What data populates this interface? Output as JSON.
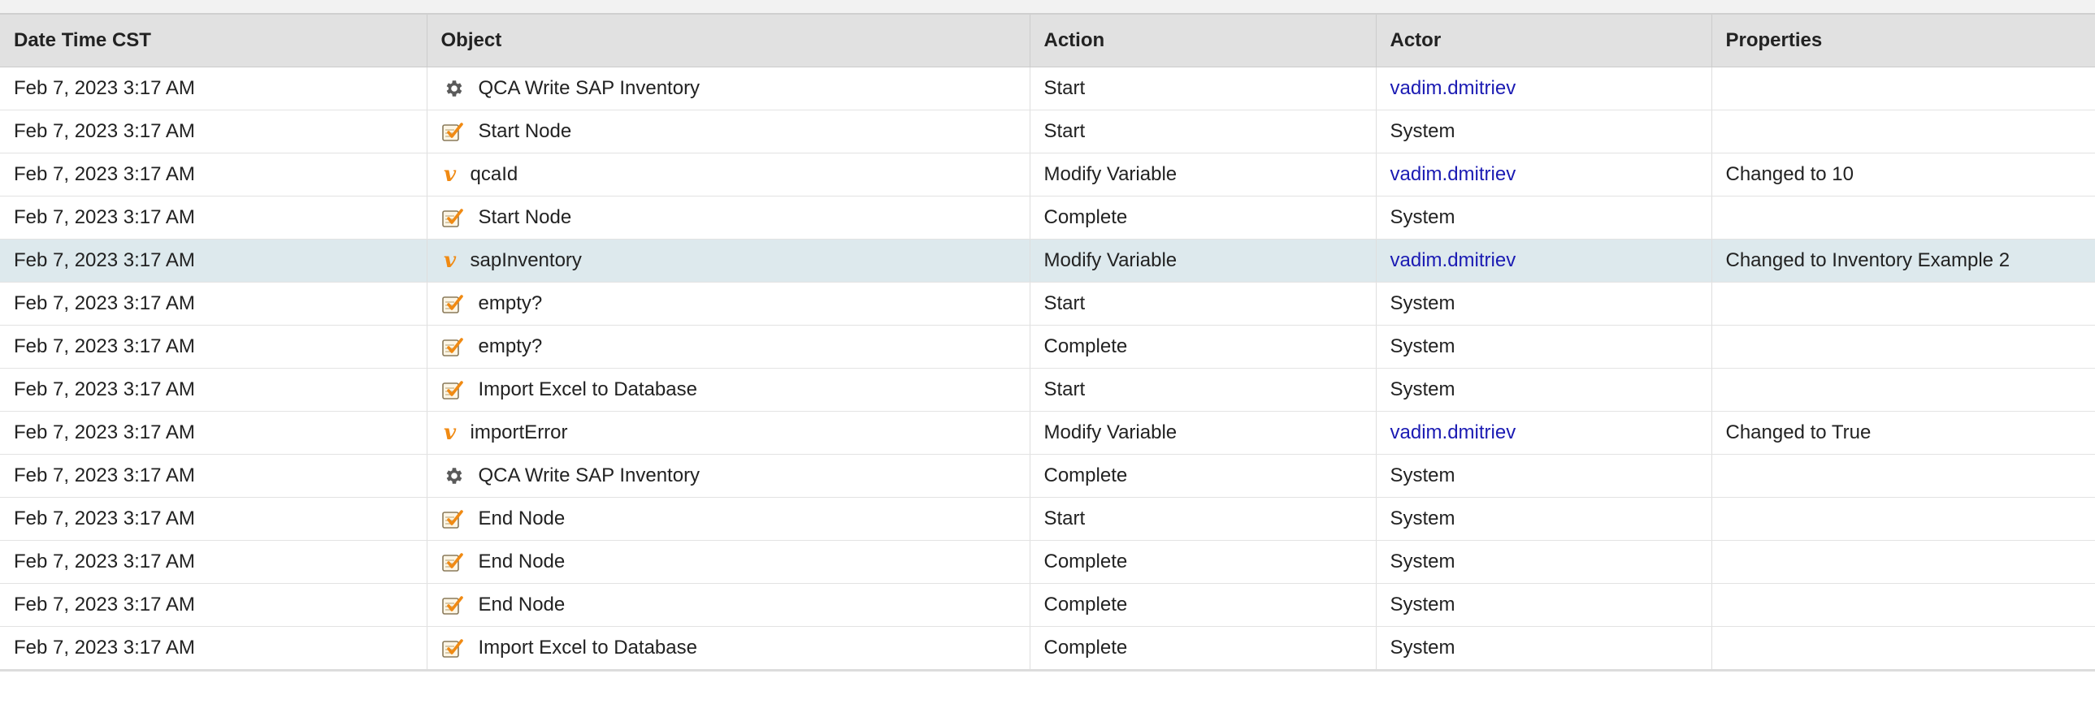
{
  "colors": {
    "link": "#1b1bb3",
    "selected_row": "#dde9ed",
    "header_bg": "#e1e1e1",
    "variable_icon": "#f08a13"
  },
  "columns": [
    "Date Time CST",
    "Object",
    "Action",
    "Actor",
    "Properties"
  ],
  "rows": [
    {
      "datetime": "Feb 7, 2023 3:17 AM",
      "icon": "gear-icon",
      "object": "QCA Write SAP Inventory",
      "action": "Start",
      "actor": "vadim.dmitriev",
      "actor_link": true,
      "properties": ""
    },
    {
      "datetime": "Feb 7, 2023 3:17 AM",
      "icon": "node-icon",
      "object": "Start Node",
      "action": "Start",
      "actor": "System",
      "actor_link": false,
      "properties": ""
    },
    {
      "datetime": "Feb 7, 2023 3:17 AM",
      "icon": "variable-icon",
      "object": "qcaId",
      "action": "Modify Variable",
      "actor": "vadim.dmitriev",
      "actor_link": true,
      "properties": "Changed to 10"
    },
    {
      "datetime": "Feb 7, 2023 3:17 AM",
      "icon": "node-icon",
      "object": "Start Node",
      "action": "Complete",
      "actor": "System",
      "actor_link": false,
      "properties": ""
    },
    {
      "datetime": "Feb 7, 2023 3:17 AM",
      "icon": "variable-icon",
      "object": "sapInventory",
      "action": "Modify Variable",
      "actor": "vadim.dmitriev",
      "actor_link": true,
      "properties": "Changed to Inventory Example 2",
      "selected": true
    },
    {
      "datetime": "Feb 7, 2023 3:17 AM",
      "icon": "node-icon",
      "object": "empty?",
      "action": "Start",
      "actor": "System",
      "actor_link": false,
      "properties": ""
    },
    {
      "datetime": "Feb 7, 2023 3:17 AM",
      "icon": "node-icon",
      "object": "empty?",
      "action": "Complete",
      "actor": "System",
      "actor_link": false,
      "properties": ""
    },
    {
      "datetime": "Feb 7, 2023 3:17 AM",
      "icon": "node-icon",
      "object": "Import Excel to Database",
      "action": "Start",
      "actor": "System",
      "actor_link": false,
      "properties": ""
    },
    {
      "datetime": "Feb 7, 2023 3:17 AM",
      "icon": "variable-icon",
      "object": "importError",
      "action": "Modify Variable",
      "actor": "vadim.dmitriev",
      "actor_link": true,
      "properties": "Changed to True"
    },
    {
      "datetime": "Feb 7, 2023 3:17 AM",
      "icon": "gear-icon",
      "object": "QCA Write SAP Inventory",
      "action": "Complete",
      "actor": "System",
      "actor_link": false,
      "properties": ""
    },
    {
      "datetime": "Feb 7, 2023 3:17 AM",
      "icon": "node-icon",
      "object": "End Node",
      "action": "Start",
      "actor": "System",
      "actor_link": false,
      "properties": ""
    },
    {
      "datetime": "Feb 7, 2023 3:17 AM",
      "icon": "node-icon",
      "object": "End Node",
      "action": "Complete",
      "actor": "System",
      "actor_link": false,
      "properties": ""
    },
    {
      "datetime": "Feb 7, 2023 3:17 AM",
      "icon": "node-icon",
      "object": "End Node",
      "action": "Complete",
      "actor": "System",
      "actor_link": false,
      "properties": ""
    },
    {
      "datetime": "Feb 7, 2023 3:17 AM",
      "icon": "node-icon",
      "object": "Import Excel to Database",
      "action": "Complete",
      "actor": "System",
      "actor_link": false,
      "properties": ""
    }
  ]
}
